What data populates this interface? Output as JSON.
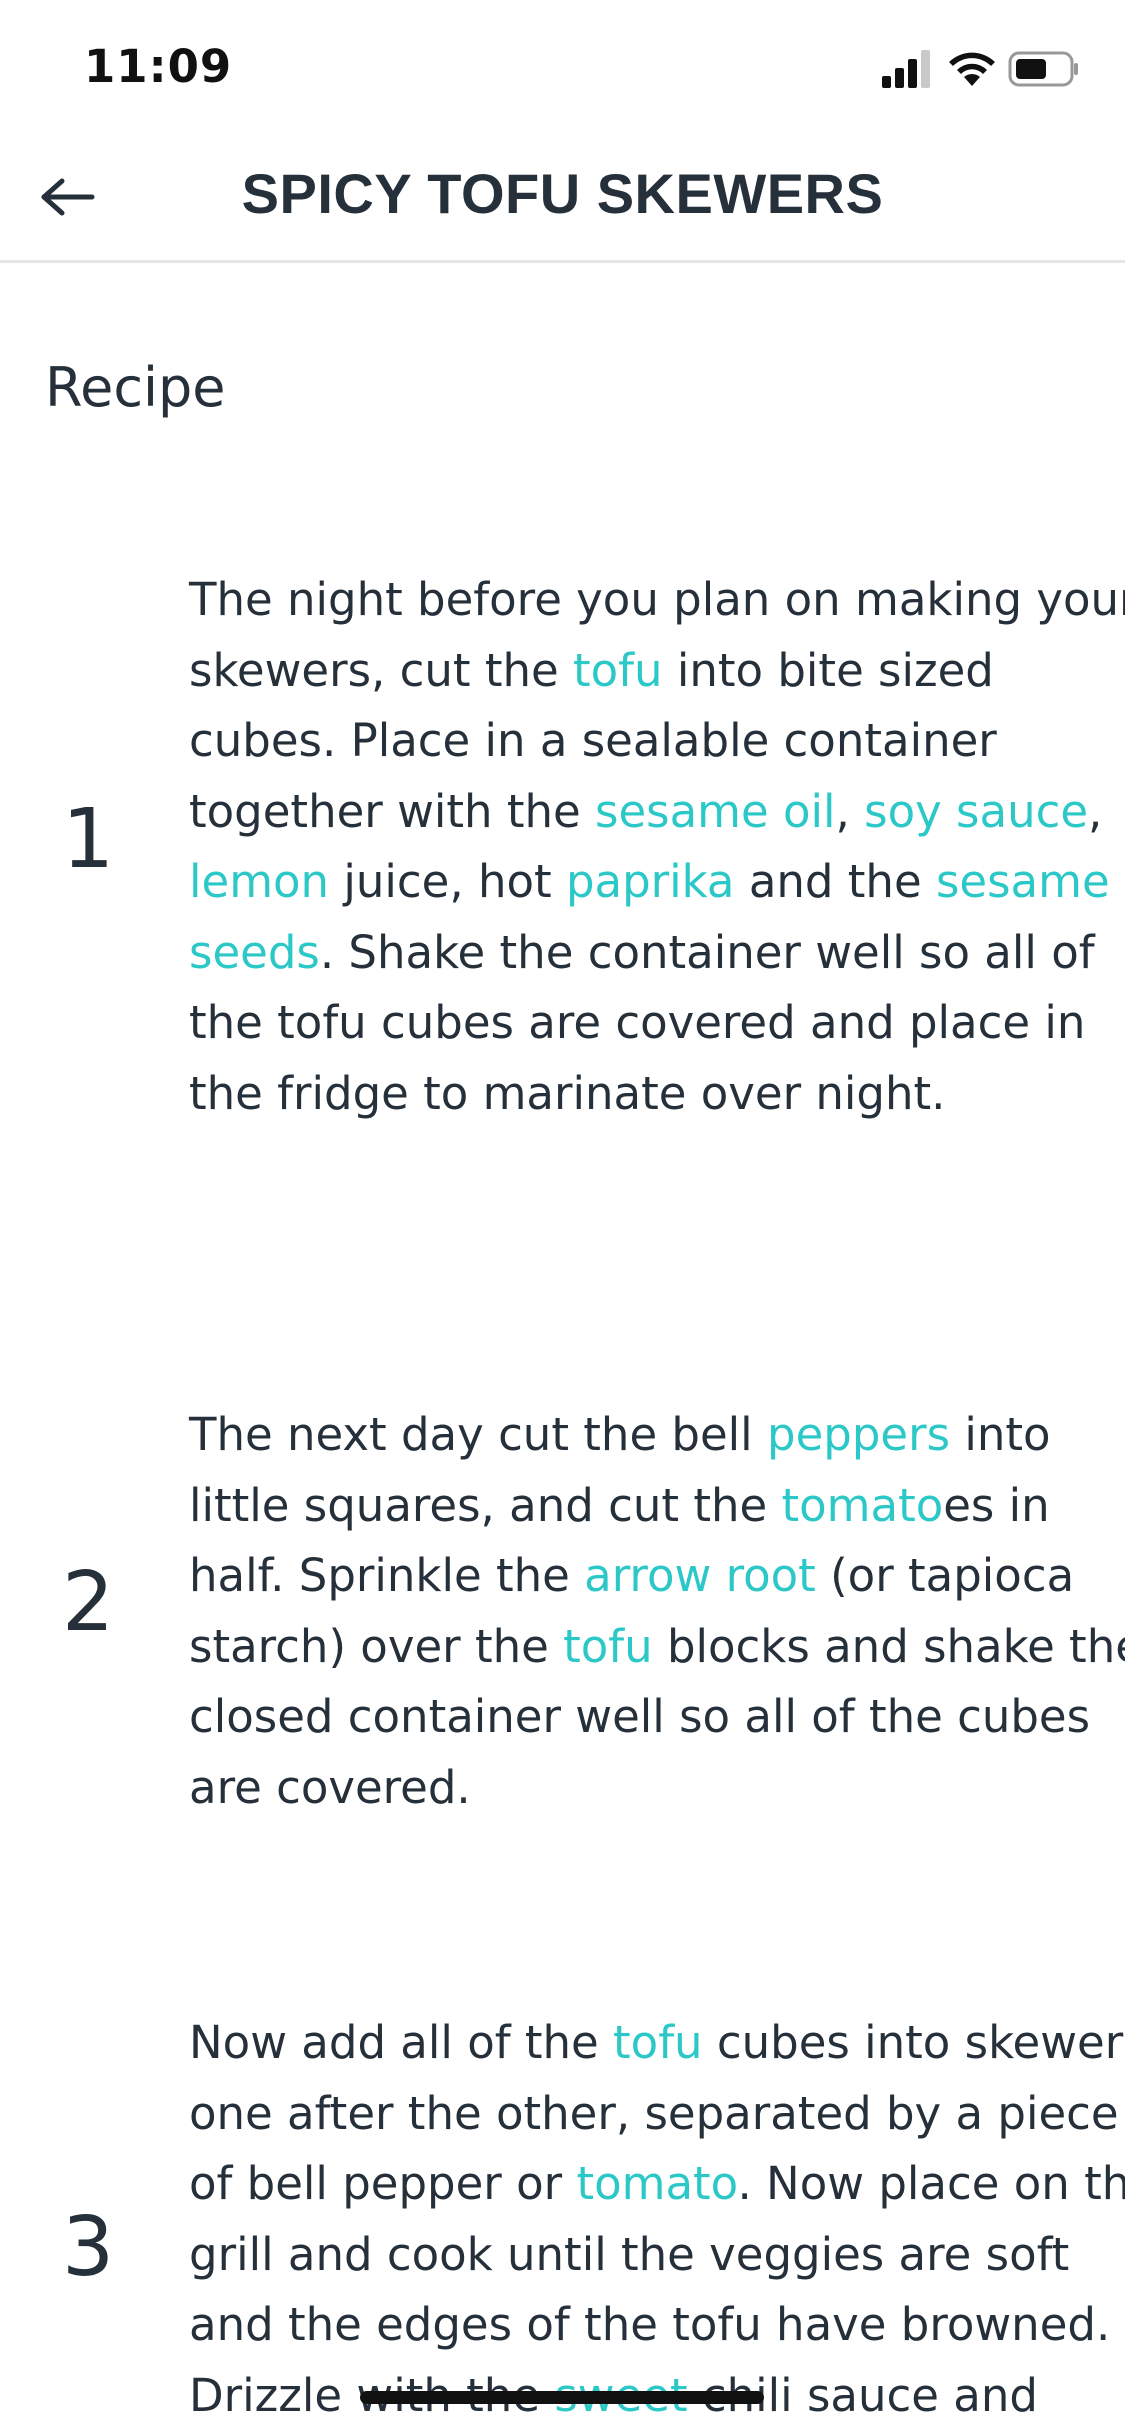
{
  "status_bar": {
    "time": "11:09"
  },
  "header": {
    "title": "SPICY TOFU SKEWERS",
    "back_icon": "arrow-left-icon"
  },
  "section": {
    "heading": "Recipe"
  },
  "steps": [
    {
      "number": "1",
      "lines": [
        [
          {
            "t": "The night before you plan on making your"
          }
        ],
        [
          {
            "t": "skewers, cut the "
          },
          {
            "t": "tofu",
            "ing": true
          },
          {
            "t": " into bite sized"
          }
        ],
        [
          {
            "t": "cubes. Place in a sealable container"
          }
        ],
        [
          {
            "t": "together with the "
          },
          {
            "t": "sesame oil",
            "ing": true
          },
          {
            "t": ", "
          },
          {
            "t": "soy sauce",
            "ing": true
          },
          {
            "t": ","
          }
        ],
        [
          {
            "t": "lemon",
            "ing": true
          },
          {
            "t": " juice, hot "
          },
          {
            "t": "paprika",
            "ing": true
          },
          {
            "t": " and the "
          },
          {
            "t": "sesame",
            "ing": true
          }
        ],
        [
          {
            "t": "seeds",
            "ing": true
          },
          {
            "t": ". Shake the container well so all of"
          }
        ],
        [
          {
            "t": "the tofu cubes are covered and place in"
          }
        ],
        [
          {
            "t": "the fridge to marinate over night."
          }
        ]
      ]
    },
    {
      "number": "2",
      "lines": [
        [
          {
            "t": "The next day cut the bell "
          },
          {
            "t": "peppers",
            "ing": true
          },
          {
            "t": " into"
          }
        ],
        [
          {
            "t": "little squares, and cut the "
          },
          {
            "t": "tomato",
            "ing": true
          },
          {
            "t": "es in"
          }
        ],
        [
          {
            "t": "half. Sprinkle the "
          },
          {
            "t": "arrow root",
            "ing": true
          },
          {
            "t": " (or tapioca"
          }
        ],
        [
          {
            "t": "starch) over the "
          },
          {
            "t": "tofu",
            "ing": true
          },
          {
            "t": " blocks and shake the"
          }
        ],
        [
          {
            "t": "closed container well so all of the cubes"
          }
        ],
        [
          {
            "t": "are covered."
          }
        ]
      ]
    },
    {
      "number": "3",
      "lines": [
        [
          {
            "t": "Now add all of the "
          },
          {
            "t": "tofu",
            "ing": true
          },
          {
            "t": " cubes into skewers"
          }
        ],
        [
          {
            "t": "one after the other, separated by a piece"
          }
        ],
        [
          {
            "t": "of bell pepper or "
          },
          {
            "t": "tomato",
            "ing": true
          },
          {
            "t": ". Now place on the"
          }
        ],
        [
          {
            "t": "grill and cook until the veggies are soft"
          }
        ],
        [
          {
            "t": "and the edges of the tofu have browned."
          }
        ],
        [
          {
            "t": "Drizzle with the "
          },
          {
            "t": "sweet",
            "ing": true
          },
          {
            "t": " chili sauce and"
          }
        ]
      ]
    }
  ],
  "colors": {
    "ingredient_link": "#2cc8c8",
    "text": "#26303a"
  }
}
